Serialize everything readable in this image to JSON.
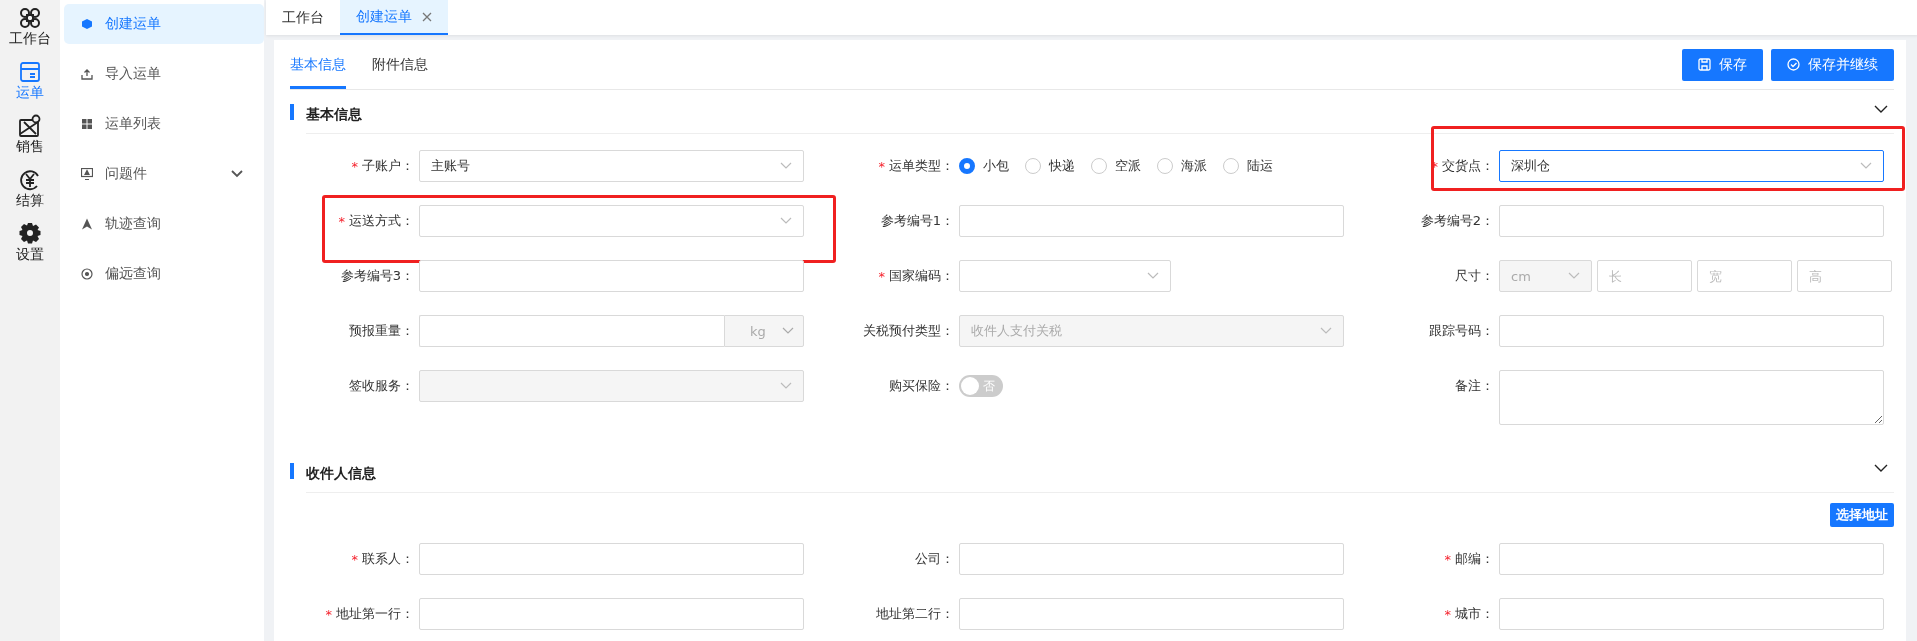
{
  "rail": {
    "items": [
      {
        "label": "工作台",
        "selected": false
      },
      {
        "label": "运单",
        "selected": true
      },
      {
        "label": "销售",
        "selected": false
      },
      {
        "label": "结算",
        "selected": false
      },
      {
        "label": "设置",
        "selected": false
      }
    ]
  },
  "sidebar": {
    "items": [
      {
        "label": "创建运单",
        "selected": true,
        "kind": "link"
      },
      {
        "label": "导入运单",
        "selected": false,
        "kind": "link"
      },
      {
        "label": "运单列表",
        "selected": false,
        "kind": "link"
      },
      {
        "label": "问题件",
        "selected": false,
        "kind": "group",
        "expanded": false
      },
      {
        "label": "轨迹查询",
        "selected": false,
        "kind": "link"
      },
      {
        "label": "偏远查询",
        "selected": false,
        "kind": "link"
      }
    ]
  },
  "page_tabs": [
    {
      "label": "工作台",
      "selected": false,
      "closable": false
    },
    {
      "label": "创建运单",
      "selected": true,
      "closable": true
    }
  ],
  "form_tabs": [
    {
      "label": "基本信息",
      "selected": true
    },
    {
      "label": "附件信息",
      "selected": false
    }
  ],
  "buttons": [
    {
      "label": "保存",
      "kind": "save"
    },
    {
      "label": "保存并继续",
      "kind": "continue"
    }
  ],
  "sections": [
    {
      "title": "基本信息",
      "expanded": true,
      "fields": [
        {
          "kind": "select",
          "required_mark": "*",
          "label": "子账户：",
          "value": "主账号",
          "disabled": false,
          "highlighted": false
        },
        {
          "kind": "radio",
          "required_mark": "*",
          "label": "运单类型：",
          "highlighted": false,
          "options": [
            {
              "label": "小包",
              "selected": true
            },
            {
              "label": "快递",
              "selected": false
            },
            {
              "label": "空派",
              "selected": false
            },
            {
              "label": "海派",
              "selected": false
            },
            {
              "label": "陆运",
              "selected": false
            }
          ]
        },
        {
          "kind": "select",
          "required_mark": "*",
          "label": "交货点：",
          "value": "深圳仓",
          "disabled": false,
          "focused": true,
          "highlighted": true
        },
        {
          "kind": "select",
          "required_mark": "*",
          "label": "运送方式：",
          "disabled": false,
          "highlighted": true
        },
        {
          "kind": "input",
          "label": "参考编号1：",
          "highlighted": false
        },
        {
          "kind": "input",
          "label": "参考编号2：",
          "highlighted": false
        },
        {
          "kind": "input",
          "label": "参考编号3：",
          "highlighted": false
        },
        {
          "kind": "select",
          "required_mark": "*",
          "label": "国家编码：",
          "disabled": false,
          "narrow": true,
          "highlighted": false
        },
        {
          "kind": "size",
          "label": "尺寸：",
          "unit": "cm",
          "highlighted": false,
          "parts": [
            {
              "placeholder": "长"
            },
            {
              "placeholder": "宽"
            },
            {
              "placeholder": "高"
            }
          ]
        },
        {
          "kind": "unit_input",
          "label": "预报重量：",
          "unit": "kg",
          "highlighted": false
        },
        {
          "kind": "select",
          "label": "关税预付类型：",
          "value": "收件人支付关税",
          "disabled": true,
          "highlighted": false
        },
        {
          "kind": "input",
          "label": "跟踪号码：",
          "highlighted": false
        },
        {
          "kind": "select",
          "label": "签收服务：",
          "disabled": true,
          "highlighted": false
        },
        {
          "kind": "toggle",
          "label": "购买保险：",
          "on": false,
          "text": "否",
          "highlighted": false
        },
        {
          "kind": "textarea",
          "label": "备注：",
          "highlighted": false
        }
      ]
    },
    {
      "title": "收件人信息",
      "expanded": true,
      "action": "选择地址",
      "fields": [
        {
          "kind": "input",
          "required_mark": "*",
          "label": "联系人：",
          "highlighted": false
        },
        {
          "kind": "input",
          "label": "公司：",
          "highlighted": false
        },
        {
          "kind": "input",
          "required_mark": "*",
          "label": "邮编：",
          "highlighted": false
        },
        {
          "kind": "input",
          "required_mark": "*",
          "label": "地址第一行：",
          "highlighted": false
        },
        {
          "kind": "input",
          "label": "地址第二行：",
          "highlighted": false
        },
        {
          "kind": "input",
          "required_mark": "*",
          "label": "城市：",
          "highlighted": false
        }
      ]
    }
  ]
}
